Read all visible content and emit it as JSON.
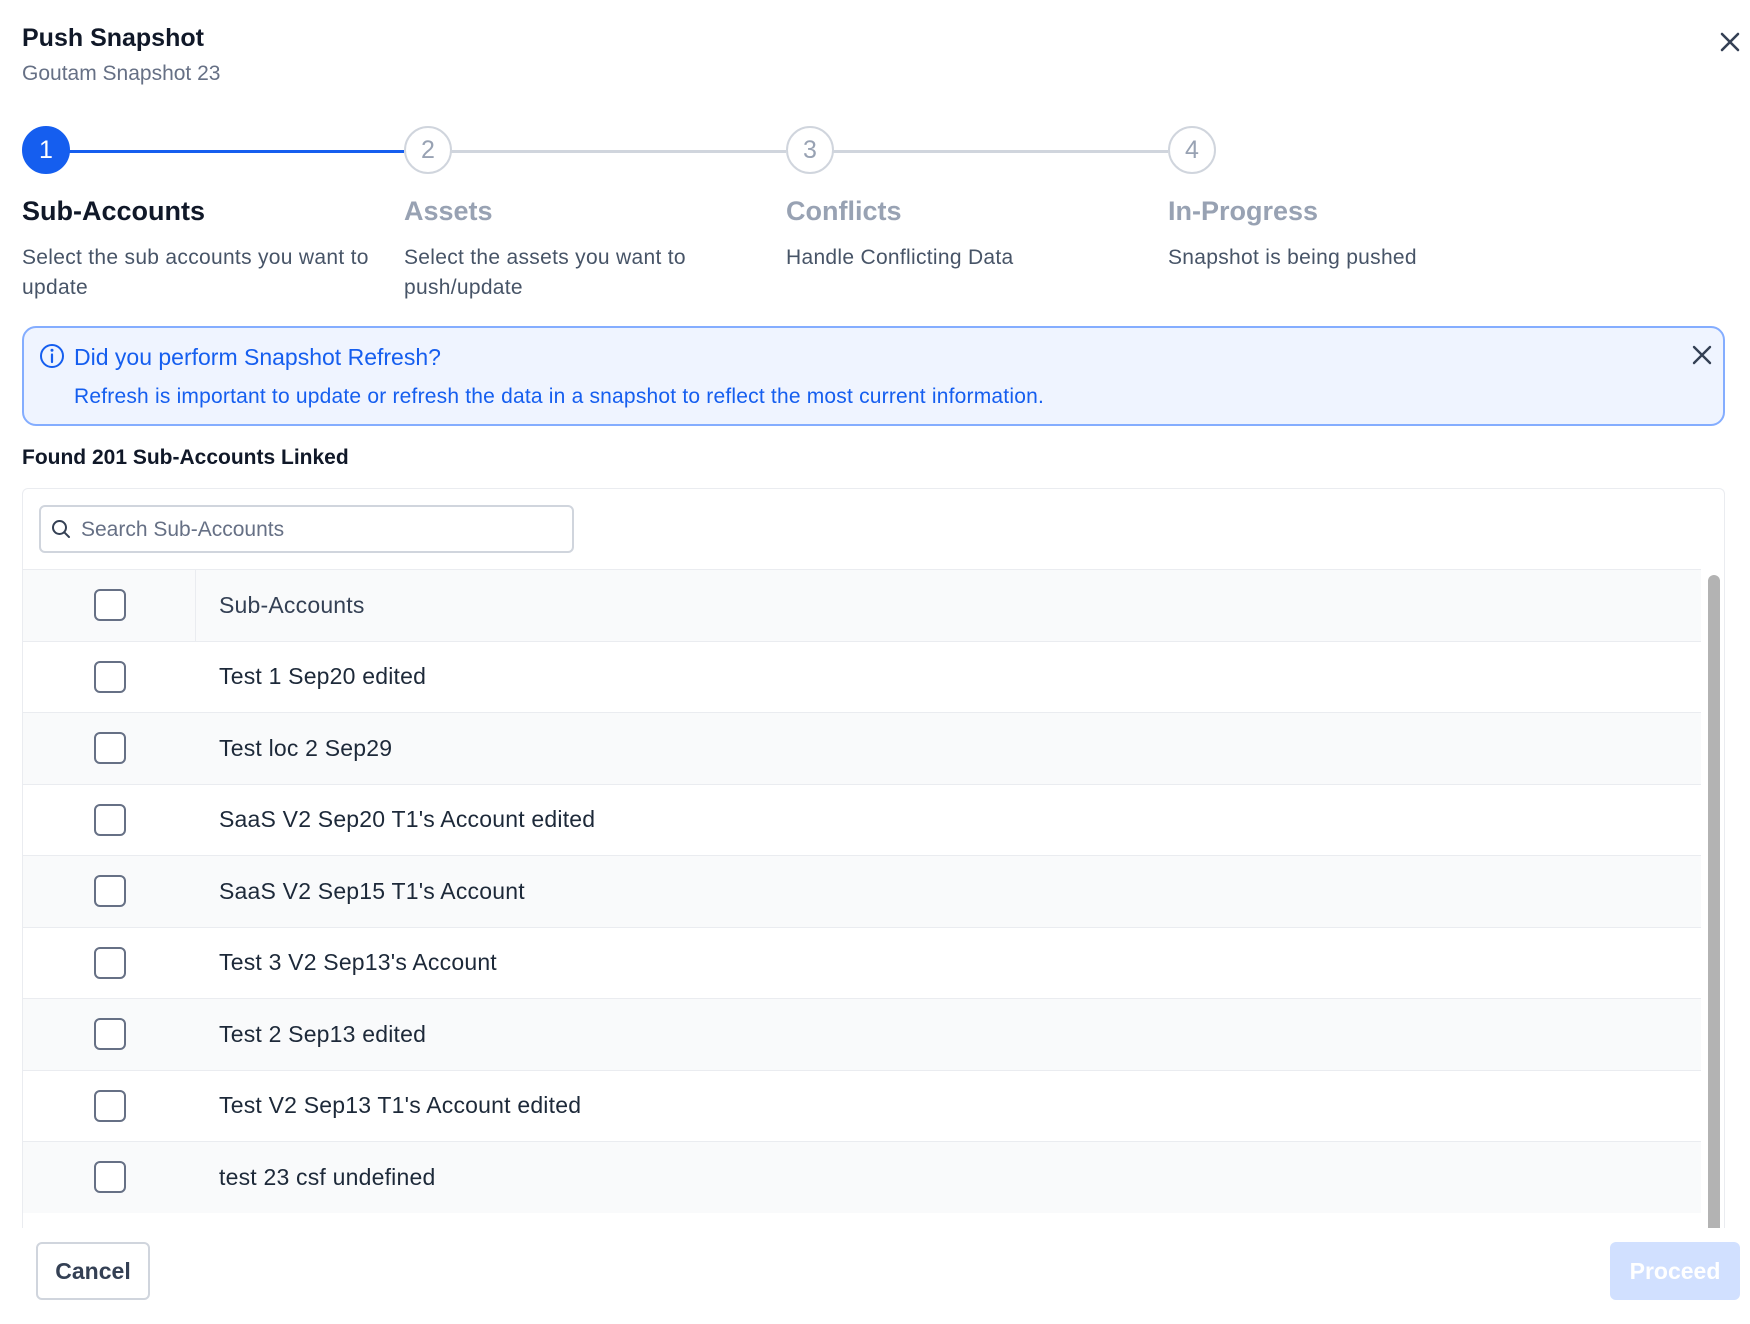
{
  "header": {
    "title": "Push Snapshot",
    "subtitle": "Goutam Snapshot 23"
  },
  "stepper": {
    "active_color": "#155eef",
    "steps": [
      {
        "number": "1",
        "title": "Sub-Accounts",
        "description": "Select the sub accounts you want to update",
        "state": "active"
      },
      {
        "number": "2",
        "title": "Assets",
        "description": "Select the assets you want to push/update",
        "state": "upcoming"
      },
      {
        "number": "3",
        "title": "Conflicts",
        "description": "Handle Conflicting Data",
        "state": "upcoming"
      },
      {
        "number": "4",
        "title": "In-Progress",
        "description": "Snapshot is being pushed",
        "state": "upcoming"
      }
    ]
  },
  "alert": {
    "icon": "info-circle-icon",
    "title": "Did you perform Snapshot Refresh?",
    "body": "Refresh is important to update or refresh the data in a snapshot to reflect the most current information."
  },
  "found_label": "Found 201 Sub-Accounts Linked",
  "search": {
    "placeholder": "Search Sub-Accounts",
    "value": ""
  },
  "table": {
    "column_header": "Sub-Accounts",
    "rows": [
      {
        "name": "Test 1 Sep20 edited",
        "checked": false
      },
      {
        "name": "Test loc 2 Sep29",
        "checked": false
      },
      {
        "name": "SaaS V2 Sep20 T1's Account edited",
        "checked": false
      },
      {
        "name": "SaaS V2 Sep15 T1's Account",
        "checked": false
      },
      {
        "name": "Test 3 V2 Sep13's Account",
        "checked": false
      },
      {
        "name": "Test 2 Sep13 edited",
        "checked": false
      },
      {
        "name": "Test V2 Sep13 T1's Account edited",
        "checked": false
      },
      {
        "name": "test 23 csf undefined",
        "checked": false
      }
    ]
  },
  "footer": {
    "cancel_label": "Cancel",
    "proceed_label": "Proceed",
    "proceed_disabled": true
  }
}
